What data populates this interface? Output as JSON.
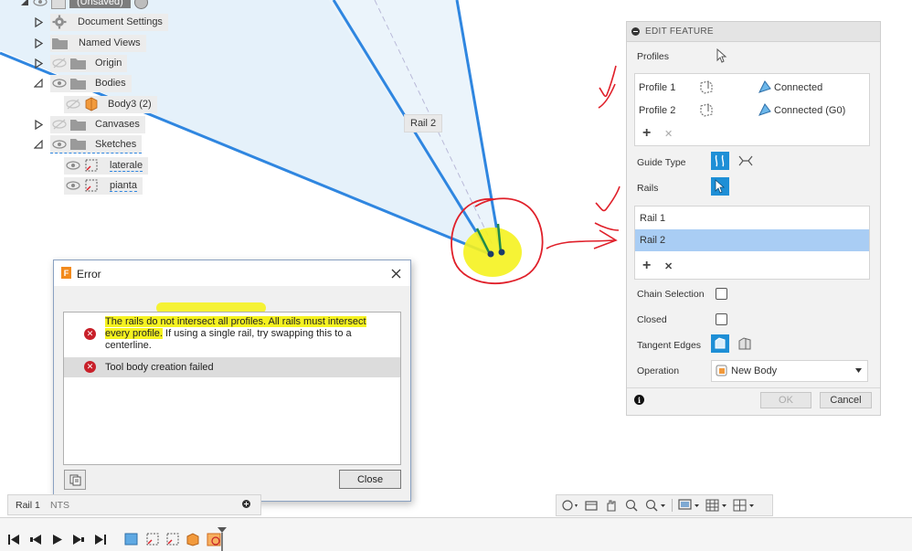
{
  "browser": {
    "root_label": "(Unsaved)",
    "items": [
      {
        "label": "Document Settings"
      },
      {
        "label": "Named Views"
      },
      {
        "label": "Origin"
      },
      {
        "label": "Bodies"
      },
      {
        "label": "Body3 (2)"
      },
      {
        "label": "Canvases"
      },
      {
        "label": "Sketches"
      },
      {
        "label": "laterale"
      },
      {
        "label": "pianta"
      }
    ]
  },
  "canvas": {
    "rail_tag": "Rail 2"
  },
  "edit_feature": {
    "title": "EDIT FEATURE",
    "profiles_label": "Profiles",
    "profiles": [
      {
        "name": "Profile 1",
        "condition": "Connected"
      },
      {
        "name": "Profile 2",
        "condition": "Connected (G0)"
      }
    ],
    "guide_type_label": "Guide Type",
    "rails_label": "Rails",
    "rails": [
      {
        "name": "Rail 1",
        "selected": false
      },
      {
        "name": "Rail 2",
        "selected": true
      }
    ],
    "chain_selection_label": "Chain Selection",
    "closed_label": "Closed",
    "tangent_edges_label": "Tangent Edges",
    "operation_label": "Operation",
    "operation_value": "New Body",
    "ok_label": "OK",
    "cancel_label": "Cancel",
    "add_symbol": "+",
    "remove_symbol": "✕"
  },
  "error_dialog": {
    "app_letter": "F",
    "title": "Error",
    "message1_highlighted_a": "The rails do not intersect all profiles. All rails must intersect",
    "message1_highlighted_b": "every profile.",
    "message1_rest": " If using a single rail, try swapping this to a centerline.",
    "message2": "Tool body creation failed",
    "close_label": "Close"
  },
  "status_bar": {
    "selection_label": "Rail 1",
    "panel_label": "NTS"
  },
  "colors": {
    "accent_blue": "#1e8fd6",
    "selection_row": "#a9cdf4",
    "rail_line": "#2f86e0",
    "highlight_yellow": "#f5f21f",
    "annotation_red": "#e0202a",
    "error_red": "#c8202a"
  }
}
